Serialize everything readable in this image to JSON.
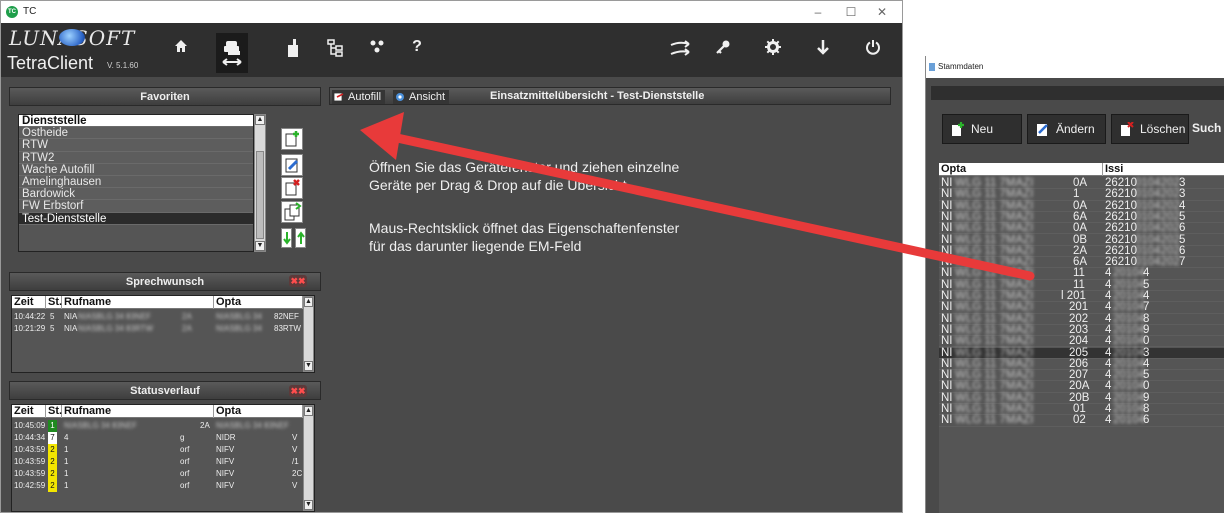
{
  "main_window": {
    "title": "TC",
    "controls": {
      "minimize": "–",
      "maximize": "☐",
      "close": "✕"
    }
  },
  "branding": {
    "logo_text": "LUNASOFT",
    "app_name": "TetraClient",
    "version": "V. 5.1.60"
  },
  "toolbar": {
    "help_label": "?"
  },
  "favorites": {
    "title": "Favoriten",
    "items": [
      "Dienststelle",
      "Ostheide",
      "RTW",
      "RTW2",
      "Wache Autofill",
      "Amelinghausen",
      "Bardowick",
      "FW Erbstorf",
      "Test-Dienststelle"
    ]
  },
  "sprechwunsch": {
    "title": "Sprechwunsch",
    "columns": [
      "Zeit",
      "St.",
      "Rufname",
      "Opta"
    ],
    "rows": [
      {
        "zeit": "10:44:22",
        "st": "5",
        "rufname": "NIA",
        "ruf_blur": "NIASBLG 34 83NEF",
        "mid": "2A",
        "opta_blur": "NIASBLG 34",
        "opta_end": "82NEF"
      },
      {
        "zeit": "10:21:29",
        "st": "5",
        "rufname": "NIA",
        "ruf_blur": "NIASBLG 34 83RTW",
        "mid": "2A",
        "opta_blur": "NIASBLG 34",
        "opta_end": "83RTW"
      }
    ]
  },
  "statusverlauf": {
    "title": "Statusverlauf",
    "columns": [
      "Zeit",
      "St.",
      "Rufname",
      "Opta"
    ],
    "rows": [
      {
        "zeit": "10:45:09",
        "st": "1",
        "color": "#1f8a1f",
        "rufname": "NIASBLG 34 83NEF",
        "mid": "2A",
        "opta": "NIASBLG 34 83NEF"
      },
      {
        "zeit": "10:44:34",
        "st": "7",
        "color": "#ffffff",
        "rufname": "4",
        "ruf_tail": "g",
        "opta": "NIDR",
        "opta_end": "V"
      },
      {
        "zeit": "10:43:59",
        "st": "2",
        "color": "#f3e600",
        "rufname": "1",
        "ruf_tail": "orf",
        "opta": "NIFV",
        "opta_end": "V"
      },
      {
        "zeit": "10:43:59",
        "st": "2",
        "color": "#f3e600",
        "rufname": "1",
        "ruf_tail": "orf",
        "opta": "NIFV",
        "opta_end": "/1"
      },
      {
        "zeit": "10:43:59",
        "st": "2",
        "color": "#f3e600",
        "rufname": "1",
        "ruf_tail": "orf",
        "opta": "NIFV",
        "opta_end": "2C"
      },
      {
        "zeit": "10:42:59",
        "st": "2",
        "color": "#f3e600",
        "rufname": "1",
        "ruf_tail": "orf",
        "opta": "NIFV",
        "opta_end": "V"
      }
    ]
  },
  "central": {
    "autofill_label": "Autofill",
    "ansicht_label": "Ansicht",
    "title": "Einsatzmittelübersicht - Test-Dienststelle",
    "instruction_1a": "Öffnen Sie das Gerätefenster und ziehen einzelne",
    "instruction_1b": "Geräte per Drag & Drop auf die Übersicht",
    "instruction_2a": "Maus-Rechtsklick öffnet das Eigenschaftenfenster",
    "instruction_2b": "für das darunter liegende EM-Feld"
  },
  "stammdaten": {
    "title": "Stammdaten",
    "buttons": {
      "new": "Neu",
      "edit": "Ändern",
      "delete": "Löschen",
      "search": "Such"
    },
    "columns": [
      "Opta",
      "Issi"
    ],
    "rows": [
      {
        "opta_start": "NI",
        "opta_end": "0A",
        "issi_start": "26210",
        "issi_end": "3"
      },
      {
        "opta_start": "NI",
        "opta_end": "1",
        "issi_start": "26210",
        "issi_end": "3"
      },
      {
        "opta_start": "NI",
        "opta_end": "0A",
        "issi_start": "26210",
        "issi_end": "4"
      },
      {
        "opta_start": "NI",
        "opta_end": "6A",
        "issi_start": "26210",
        "issi_end": "5"
      },
      {
        "opta_start": "NI",
        "opta_end": "0A",
        "issi_start": "26210",
        "issi_end": "6"
      },
      {
        "opta_start": "NI",
        "opta_end": "0B",
        "issi_start": "26210",
        "issi_end": "5"
      },
      {
        "opta_start": "NI",
        "opta_end": "2A",
        "issi_start": "26210",
        "issi_end": "6"
      },
      {
        "opta_start": "NI",
        "opta_end": "6A",
        "issi_start": "26210",
        "issi_end": "7"
      },
      {
        "opta_start": "NI",
        "opta_end": "11",
        "issi_start": "4",
        "issi_end": "4"
      },
      {
        "opta_start": "NI",
        "opta_end": "11",
        "issi_start": "4",
        "issi_end": "5"
      },
      {
        "opta_start": "NI",
        "opta_end": "l 201",
        "issi_start": "4",
        "issi_end": "4"
      },
      {
        "opta_start": "NI",
        "opta_end": "201",
        "issi_start": "4",
        "issi_end": "7"
      },
      {
        "opta_start": "NI",
        "opta_end": "202",
        "issi_start": "4",
        "issi_end": "8"
      },
      {
        "opta_start": "NI",
        "opta_end": "203",
        "issi_start": "4",
        "issi_end": "9"
      },
      {
        "opta_start": "NI",
        "opta_end": "204",
        "issi_start": "4",
        "issi_end": "0"
      },
      {
        "opta_start": "NI",
        "opta_end": "205",
        "issi_start": "4",
        "issi_end": "3"
      },
      {
        "opta_start": "NI",
        "opta_end": "206",
        "issi_start": "4",
        "issi_end": "4"
      },
      {
        "opta_start": "NI",
        "opta_end": "207",
        "issi_start": "4",
        "issi_end": "5"
      },
      {
        "opta_start": "NI",
        "opta_end": "20A",
        "issi_start": "4",
        "issi_end": "0"
      },
      {
        "opta_start": "NI",
        "opta_end": "20B",
        "issi_start": "4",
        "issi_end": "9"
      },
      {
        "opta_start": "NI",
        "opta_end": "01",
        "issi_start": "4",
        "issi_end": "8"
      },
      {
        "opta_start": "NI",
        "opta_end": "02",
        "issi_start": "4",
        "issi_end": "6"
      }
    ]
  },
  "colors": {
    "annotation_arrow": "#e83a3a",
    "status_green": "#1f8a1f",
    "status_yellow": "#f3e600"
  }
}
